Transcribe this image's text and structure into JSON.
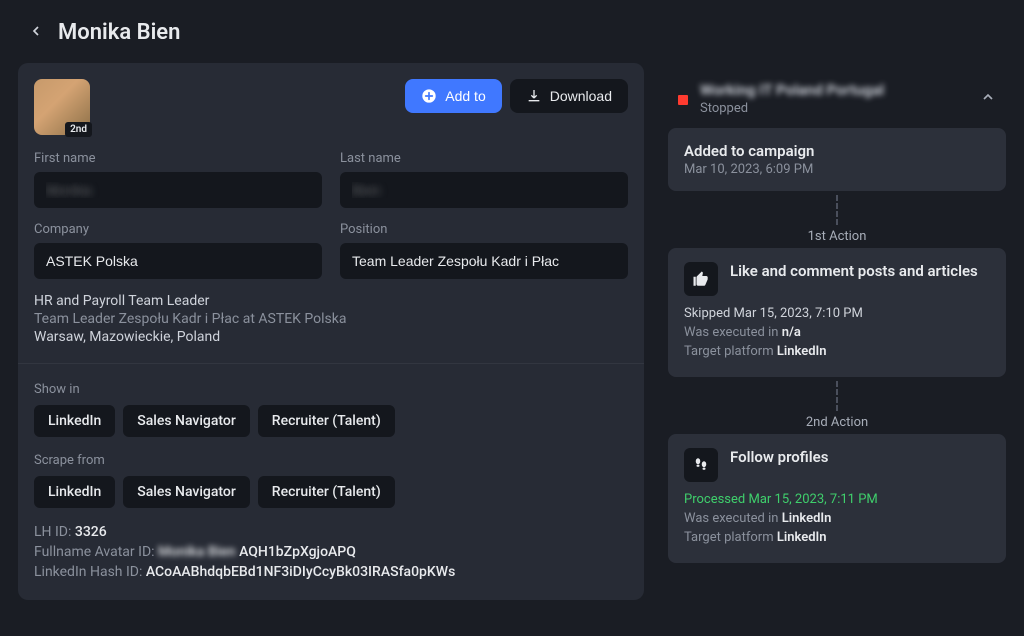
{
  "header": {
    "title": "Monika Bien"
  },
  "profile": {
    "badge": "2nd",
    "actions": {
      "add_to": "Add to",
      "download": "Download"
    },
    "first_name_label": "First name",
    "first_name_value": "Monika",
    "last_name_label": "Last name",
    "last_name_value": "Bien",
    "company_label": "Company",
    "company_value": "ASTEK Polska",
    "position_label": "Position",
    "position_value": "Team Leader Zespołu Kadr i Płac",
    "role": "HR and Payroll Team Leader",
    "headline": "Team Leader Zespołu Kadr i Płac at ASTEK Polska",
    "location": "Warsaw, Mazowieckie, Poland"
  },
  "links": {
    "show_in_label": "Show in",
    "scrape_from_label": "Scrape from",
    "chips": [
      "LinkedIn",
      "Sales Navigator",
      "Recruiter (Talent)"
    ]
  },
  "meta": {
    "lh_id_label": "LH ID: ",
    "lh_id": "3326",
    "avatar_id_label": "Fullname Avatar ID: ",
    "avatar_id_blur": "Monika Bien ",
    "avatar_id": "AQH1bZpXgjoAPQ",
    "hash_label": "LinkedIn Hash ID: ",
    "hash": "ACoAABhdqbEBd1NF3iDIyCcyBk03IRASfa0pKWs"
  },
  "campaign": {
    "name": "Working IT Poland Portugal",
    "status": "Stopped",
    "added": {
      "title": "Added to campaign",
      "timestamp": "Mar 10, 2023, 6:09 PM"
    },
    "action1_label": "1st Action",
    "action1": {
      "title": "Like and comment posts and articles",
      "status_prefix": "Skipped ",
      "status_time": "Mar 15, 2023, 7:10 PM",
      "exec_prefix": "Was executed in ",
      "exec_val": "n/a",
      "platform_prefix": "Target platform ",
      "platform": "LinkedIn"
    },
    "action2_label": "2nd Action",
    "action2": {
      "title": "Follow profiles",
      "status_prefix": "Processed ",
      "status_time": "Mar 15, 2023, 7:11 PM",
      "exec_prefix": "Was executed in ",
      "exec_val": "LinkedIn",
      "platform_prefix": "Target platform ",
      "platform": "LinkedIn"
    }
  }
}
